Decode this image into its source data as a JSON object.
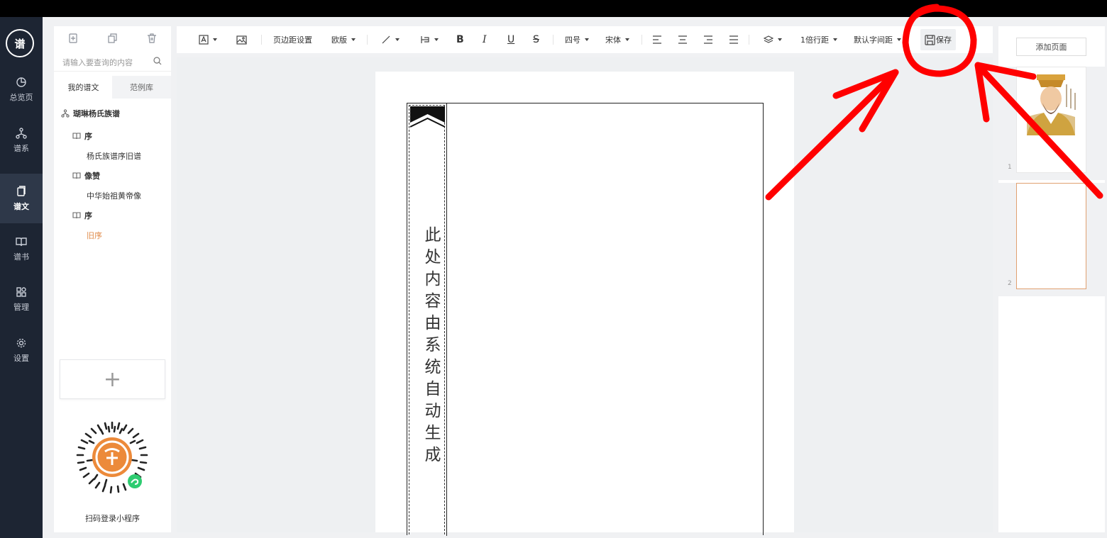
{
  "nav": {
    "logo_text": "谱",
    "items": [
      {
        "label": "总览页",
        "icon": "pie-chart-icon"
      },
      {
        "label": "谱系",
        "icon": "tree-icon"
      },
      {
        "label": "谱文",
        "icon": "document-icon",
        "active": true
      },
      {
        "label": "谱书",
        "icon": "book-icon"
      },
      {
        "label": "管理",
        "icon": "grid-icon"
      },
      {
        "label": "设置",
        "icon": "gear-icon"
      }
    ]
  },
  "left_panel": {
    "search_placeholder": "请输入要查询的内容",
    "tabs": [
      "我的谱文",
      "范例库"
    ],
    "tree": {
      "root": "瑚琳杨氏族谱",
      "nodes": [
        {
          "label": "序",
          "children": [
            "杨氏族谱序旧谱"
          ]
        },
        {
          "label": "像赞",
          "children": [
            "中华始祖黄帝像"
          ]
        },
        {
          "label": "序",
          "children": [
            "旧序"
          ]
        }
      ]
    },
    "add_symbol": "+",
    "qr_caption": "扫码登录小程序"
  },
  "toolbar": {
    "margin_settings": "页边距设置",
    "layout": "欧版",
    "bold": "B",
    "italic": "I",
    "underline": "U",
    "strike": "S",
    "font_size": "四号",
    "font_family": "宋体",
    "line_spacing": "1倍行距",
    "letter_spacing": "默认字间距",
    "save": "保存"
  },
  "page": {
    "spine_text": "此处内容由系统自动生成"
  },
  "right_panel": {
    "add_page": "添加页面",
    "thumbnails": [
      {
        "number": "1",
        "content": "emperor-portrait"
      },
      {
        "number": "2",
        "content": "blank",
        "selected": true
      }
    ]
  },
  "colors": {
    "nav_bg": "#1d2533",
    "accent_orange": "#e08a48",
    "annotation_red": "#ff0000"
  }
}
